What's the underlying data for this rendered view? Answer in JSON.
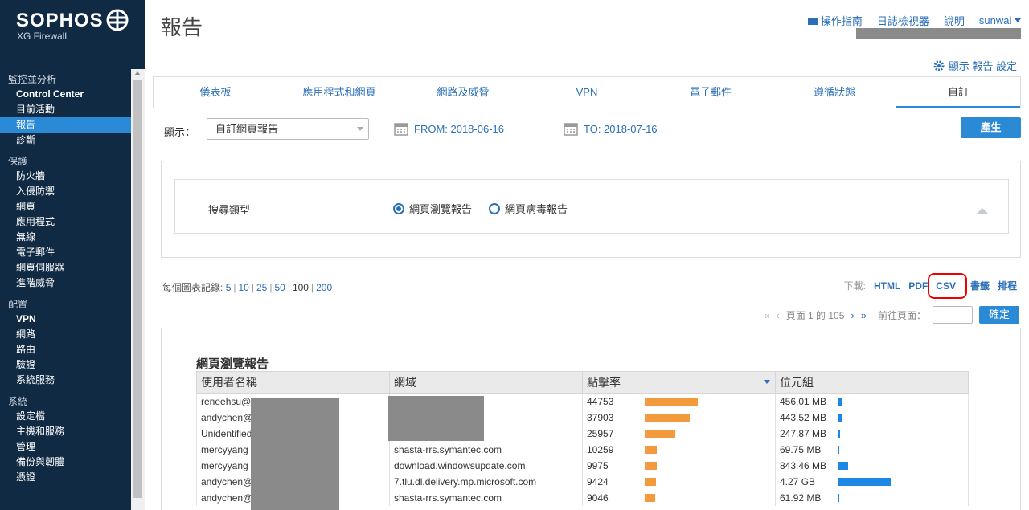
{
  "brand": {
    "name": "SOPHOS",
    "product": "XG Firewall"
  },
  "sidebar": {
    "groups": [
      {
        "title": "監控並分析",
        "items": [
          {
            "label": "Control Center",
            "bold": true
          },
          {
            "label": "目前活動"
          },
          {
            "label": "報告",
            "active": true
          },
          {
            "label": "診斷"
          }
        ]
      },
      {
        "title": "保護",
        "items": [
          {
            "label": "防火牆"
          },
          {
            "label": "入侵防禦"
          },
          {
            "label": "網頁"
          },
          {
            "label": "應用程式"
          },
          {
            "label": "無線"
          },
          {
            "label": "電子郵件"
          },
          {
            "label": "網頁伺服器"
          },
          {
            "label": "進階威脅"
          }
        ]
      },
      {
        "title": "配置",
        "items": [
          {
            "label": "VPN",
            "bold": true
          },
          {
            "label": "網路"
          },
          {
            "label": "路由"
          },
          {
            "label": "驗證"
          },
          {
            "label": "系統服務"
          }
        ]
      },
      {
        "title": "系統",
        "items": [
          {
            "label": "設定檔"
          },
          {
            "label": "主機和服務"
          },
          {
            "label": "管理"
          },
          {
            "label": "備份與韌體"
          },
          {
            "label": "憑證"
          }
        ]
      }
    ]
  },
  "header": {
    "title": "報告",
    "guide": "操作指南",
    "log_viewer": "日誌檢視器",
    "help": "說明",
    "user": "sunwai",
    "report_settings": "顯示 報告 設定"
  },
  "tabs": [
    {
      "label": "儀表板"
    },
    {
      "label": "應用程式和網頁"
    },
    {
      "label": "網路及威脅"
    },
    {
      "label": "VPN"
    },
    {
      "label": "電子郵件"
    },
    {
      "label": "遵循狀態"
    },
    {
      "label": "自訂",
      "active": true
    }
  ],
  "filters": {
    "show_label": "顯示：",
    "report_select": "自訂網頁報告",
    "from": "FROM: 2018-06-16",
    "to": "TO: 2018-07-16",
    "generate": "產生"
  },
  "search": {
    "label": "搜尋類型",
    "option_browse": "網頁瀏覽報告",
    "option_virus": "網頁病毒報告",
    "selected": "browse"
  },
  "records": {
    "label": "每個圖表記錄:",
    "options": [
      "5",
      "10",
      "25",
      "50",
      "100",
      "200"
    ],
    "current": "100"
  },
  "download": {
    "label": "下載:",
    "html": "HTML",
    "pdf": "PDF",
    "csv": "CSV",
    "bookmark": "書籤",
    "schedule": "排程"
  },
  "pager": {
    "page_text": "頁面 1 的 105",
    "goto_label": "前往頁面：",
    "goto_button": "確定"
  },
  "report": {
    "title": "網頁瀏覽報告",
    "columns": [
      "使用者名稱",
      "網域",
      "點擊率",
      "位元組"
    ],
    "rows": [
      {
        "user": "reneehsu@",
        "domain": "",
        "hits": "44753",
        "hits_frac": 1.0,
        "bytes": "456.01 MB",
        "bytes_frac": 0.09
      },
      {
        "user": "andychen@",
        "domain": "",
        "hits": "37903",
        "hits_frac": 0.85,
        "bytes": "443.52 MB",
        "bytes_frac": 0.09
      },
      {
        "user": "Unidentified",
        "domain": "",
        "hits": "25957",
        "hits_frac": 0.58,
        "bytes": "247.87 MB",
        "bytes_frac": 0.05
      },
      {
        "user": "mercyyang",
        "domain": "shasta-rrs.symantec.com",
        "hits": "10259",
        "hits_frac": 0.23,
        "bytes": "69.75 MB",
        "bytes_frac": 0.02
      },
      {
        "user": "mercyyang",
        "domain": "download.windowsupdate.com",
        "hits": "9975",
        "hits_frac": 0.22,
        "bytes": "843.46 MB",
        "bytes_frac": 0.2
      },
      {
        "user": "andychen@",
        "domain": "7.tlu.dl.delivery.mp.microsoft.com",
        "hits": "9424",
        "hits_frac": 0.21,
        "bytes": "4.27 GB",
        "bytes_frac": 1.0
      },
      {
        "user": "andychen@",
        "domain": "shasta-rrs.symantec.com",
        "hits": "9046",
        "hits_frac": 0.2,
        "bytes": "61.92 MB",
        "bytes_frac": 0.02
      }
    ]
  }
}
